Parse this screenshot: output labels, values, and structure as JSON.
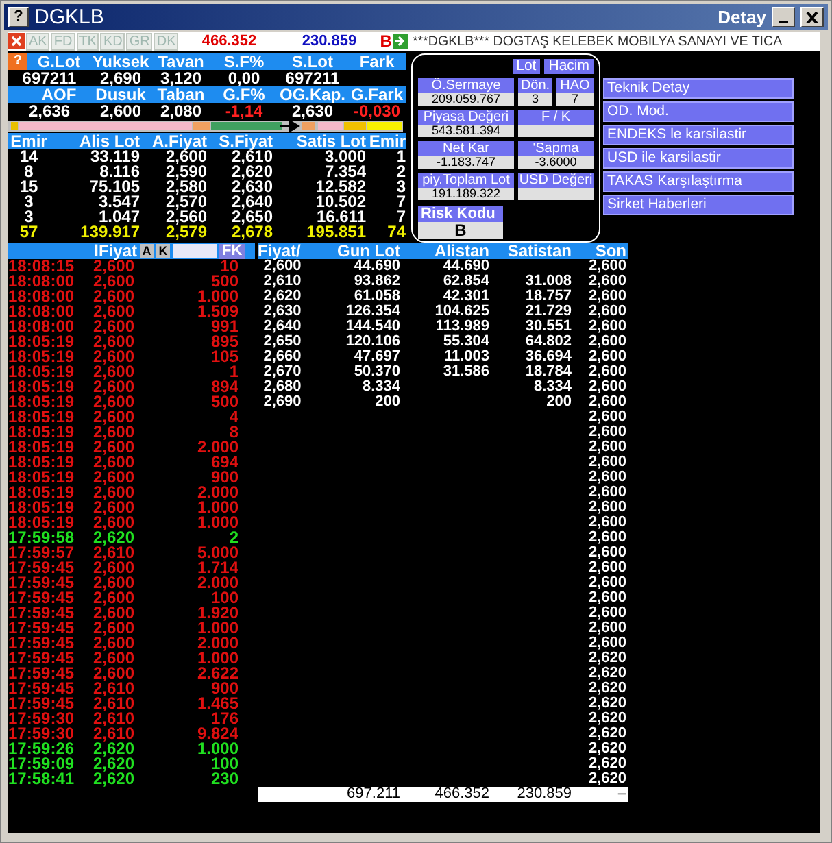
{
  "window": {
    "help": "?",
    "title": "DGKLB",
    "detail_label": "Detay"
  },
  "summary_help": "?",
  "toolbar": {
    "tabs": [
      "AK",
      "FD",
      "TK",
      "KD",
      "GR",
      "DK"
    ],
    "value_1": "466.352",
    "value_2": "230.859",
    "flag": "B",
    "ticker": "***DGKLB*** DOGTAŞ KELEBEK MOBILYA SANAYI VE TICA"
  },
  "summary": [
    {
      "headers": [
        "G.Lot",
        "Yuksek",
        "Tavan",
        "S.F%",
        "S.Lot",
        "Fark"
      ],
      "values": [
        {
          "text": "697211",
          "negative": false
        },
        {
          "text": "2,690",
          "negative": false
        },
        {
          "text": "3,120",
          "negative": false
        },
        {
          "text": "0,00",
          "negative": false
        },
        {
          "text": "697211",
          "negative": false
        }
      ]
    },
    {
      "headers": [
        "AOF",
        "Dusuk",
        "Taban",
        "G.F%",
        "OG.Kap.",
        "G.Fark"
      ],
      "values": [
        {
          "text": "2,636",
          "negative": false
        },
        {
          "text": "2,600",
          "negative": false
        },
        {
          "text": "2,080",
          "negative": false
        },
        {
          "text": "-1,14",
          "negative": true
        },
        {
          "text": "2,630",
          "negative": false
        },
        {
          "text": "-0,030",
          "negative": true
        }
      ]
    }
  ],
  "order_book": {
    "columns": [
      "Emir",
      "Alis Lot",
      "A.Fiyat",
      "S.Fiyat",
      "Satis Lot",
      "Emir"
    ],
    "rows": [
      [
        "14",
        "33.119",
        "2,600",
        "2,610",
        "3.000",
        "1"
      ],
      [
        "8",
        "8.116",
        "2,590",
        "2,620",
        "7.354",
        "2"
      ],
      [
        "15",
        "75.105",
        "2,580",
        "2,630",
        "12.582",
        "3"
      ],
      [
        "3",
        "3.547",
        "2,570",
        "2,640",
        "10.502",
        "7"
      ],
      [
        "3",
        "1.047",
        "2,560",
        "2,650",
        "16.611",
        "7"
      ]
    ],
    "total": [
      "57",
      "139.917",
      "2,579",
      "2,678",
      "195.851",
      "74"
    ]
  },
  "info_panel": {
    "buttons": [
      "Lot",
      "Hacim"
    ],
    "fields": [
      [
        {
          "label": "Ö.Sermaye",
          "value": "209.059.767"
        },
        {
          "label": "Dön.",
          "value": "3"
        },
        {
          "label": "HAO",
          "value": "7"
        }
      ],
      [
        {
          "label": "Piyasa Değeri",
          "value": "543.581.394"
        },
        {
          "label": "F / K"
        }
      ],
      [
        {
          "label": "Net Kar",
          "value": "-1.183.747"
        },
        {
          "label": "'Sapma",
          "value": "-3.6000"
        }
      ],
      [
        {
          "label": "piy.Toplam Lot",
          "value": "191.189.322"
        },
        {
          "label": "USD Değeri"
        }
      ]
    ],
    "risk": {
      "label": "Risk Kodu",
      "value": "B"
    }
  },
  "actions": [
    "Teknik Detay",
    "OD. Mod.",
    "ENDEKS le karsilastir",
    "USD ile karsilastir",
    "TAKAS Karşılaştırma",
    "Sirket Haberleri"
  ],
  "trades": {
    "header": "lFiyat",
    "buttons": [
      "A",
      "K"
    ],
    "filter_button": "FK",
    "rows": [
      {
        "time": "18:08:15",
        "price": "2,600",
        "lot": "10",
        "up": false
      },
      {
        "time": "18:08:00",
        "price": "2,600",
        "lot": "500",
        "up": false
      },
      {
        "time": "18:08:00",
        "price": "2,600",
        "lot": "1.000",
        "up": false
      },
      {
        "time": "18:08:00",
        "price": "2,600",
        "lot": "1.509",
        "up": false
      },
      {
        "time": "18:08:00",
        "price": "2,600",
        "lot": "991",
        "up": false
      },
      {
        "time": "18:05:19",
        "price": "2,600",
        "lot": "895",
        "up": false
      },
      {
        "time": "18:05:19",
        "price": "2,600",
        "lot": "105",
        "up": false
      },
      {
        "time": "18:05:19",
        "price": "2,600",
        "lot": "1",
        "up": false
      },
      {
        "time": "18:05:19",
        "price": "2,600",
        "lot": "894",
        "up": false
      },
      {
        "time": "18:05:19",
        "price": "2,600",
        "lot": "500",
        "up": false
      },
      {
        "time": "18:05:19",
        "price": "2,600",
        "lot": "4",
        "up": false
      },
      {
        "time": "18:05:19",
        "price": "2,600",
        "lot": "8",
        "up": false
      },
      {
        "time": "18:05:19",
        "price": "2,600",
        "lot": "2.000",
        "up": false
      },
      {
        "time": "18:05:19",
        "price": "2,600",
        "lot": "694",
        "up": false
      },
      {
        "time": "18:05:19",
        "price": "2,600",
        "lot": "900",
        "up": false
      },
      {
        "time": "18:05:19",
        "price": "2,600",
        "lot": "2.000",
        "up": false
      },
      {
        "time": "18:05:19",
        "price": "2,600",
        "lot": "1.000",
        "up": false
      },
      {
        "time": "18:05:19",
        "price": "2,600",
        "lot": "1.000",
        "up": false
      },
      {
        "time": "17:59:58",
        "price": "2,620",
        "lot": "2",
        "up": true
      },
      {
        "time": "17:59:57",
        "price": "2,610",
        "lot": "5.000",
        "up": false
      },
      {
        "time": "17:59:45",
        "price": "2,600",
        "lot": "1.714",
        "up": false
      },
      {
        "time": "17:59:45",
        "price": "2,600",
        "lot": "2.000",
        "up": false
      },
      {
        "time": "17:59:45",
        "price": "2,600",
        "lot": "100",
        "up": false
      },
      {
        "time": "17:59:45",
        "price": "2,600",
        "lot": "1.920",
        "up": false
      },
      {
        "time": "17:59:45",
        "price": "2,600",
        "lot": "1.000",
        "up": false
      },
      {
        "time": "17:59:45",
        "price": "2,600",
        "lot": "2.000",
        "up": false
      },
      {
        "time": "17:59:45",
        "price": "2,600",
        "lot": "1.000",
        "up": false
      },
      {
        "time": "17:59:45",
        "price": "2,600",
        "lot": "2.622",
        "up": false
      },
      {
        "time": "17:59:45",
        "price": "2,610",
        "lot": "900",
        "up": false
      },
      {
        "time": "17:59:45",
        "price": "2,610",
        "lot": "1.465",
        "up": false
      },
      {
        "time": "17:59:30",
        "price": "2,610",
        "lot": "176",
        "up": false
      },
      {
        "time": "17:59:30",
        "price": "2,610",
        "lot": "9.824",
        "up": false
      },
      {
        "time": "17:59:26",
        "price": "2,620",
        "lot": "1.000",
        "up": true
      },
      {
        "time": "17:59:09",
        "price": "2,620",
        "lot": "100",
        "up": true
      },
      {
        "time": "17:58:41",
        "price": "2,620",
        "lot": "230",
        "up": true
      }
    ]
  },
  "price_table": {
    "columns": [
      "Fiyat/",
      "Gun Lot",
      "Alistan",
      "Satistan",
      "Son"
    ],
    "rows": [
      {
        "price": "2,600",
        "gun_lot": "44.690",
        "alistan": "44.690",
        "son": "2,600"
      },
      {
        "price": "2,610",
        "gun_lot": "93.862",
        "alistan": "62.854",
        "satistan": "31.008",
        "son": "2,600"
      },
      {
        "price": "2,620",
        "gun_lot": "61.058",
        "alistan": "42.301",
        "satistan": "18.757",
        "son": "2,600"
      },
      {
        "price": "2,630",
        "gun_lot": "126.354",
        "alistan": "104.625",
        "satistan": "21.729",
        "son": "2,600"
      },
      {
        "price": "2,640",
        "gun_lot": "144.540",
        "alistan": "113.989",
        "satistan": "30.551",
        "son": "2,600"
      },
      {
        "price": "2,650",
        "gun_lot": "120.106",
        "alistan": "55.304",
        "satistan": "64.802",
        "son": "2,600"
      },
      {
        "price": "2,660",
        "gun_lot": "47.697",
        "alistan": "11.003",
        "satistan": "36.694",
        "son": "2,600"
      },
      {
        "price": "2,670",
        "gun_lot": "50.370",
        "alistan": "31.586",
        "satistan": "18.784",
        "son": "2,600"
      },
      {
        "price": "2,680",
        "gun_lot": "8.334",
        "satistan": "8.334",
        "son": "2,600"
      },
      {
        "price": "2,690",
        "gun_lot": "200",
        "satistan": "200",
        "son": "2,600"
      },
      {
        "son": "2,600"
      },
      {
        "son": "2,600"
      },
      {
        "son": "2,600"
      },
      {
        "son": "2,600"
      },
      {
        "son": "2,600"
      },
      {
        "son": "2,600"
      },
      {
        "son": "2,600"
      },
      {
        "son": "2,600"
      },
      {
        "son": "2,600"
      },
      {
        "son": "2,600"
      },
      {
        "son": "2,600"
      },
      {
        "son": "2,600"
      },
      {
        "son": "2,600"
      },
      {
        "son": "2,600"
      },
      {
        "son": "2,600"
      },
      {
        "son": "2,600"
      },
      {
        "son": "2,620"
      },
      {
        "son": "2,620"
      },
      {
        "son": "2,620"
      },
      {
        "son": "2,620"
      },
      {
        "son": "2,620"
      },
      {
        "son": "2,620"
      },
      {
        "son": "2,620"
      },
      {
        "son": "2,620"
      },
      {
        "son": "2,620"
      }
    ],
    "total": {
      "gun_lot": "697.211",
      "alistan": "466.352",
      "satistan": "230.859",
      "son": "–"
    }
  }
}
